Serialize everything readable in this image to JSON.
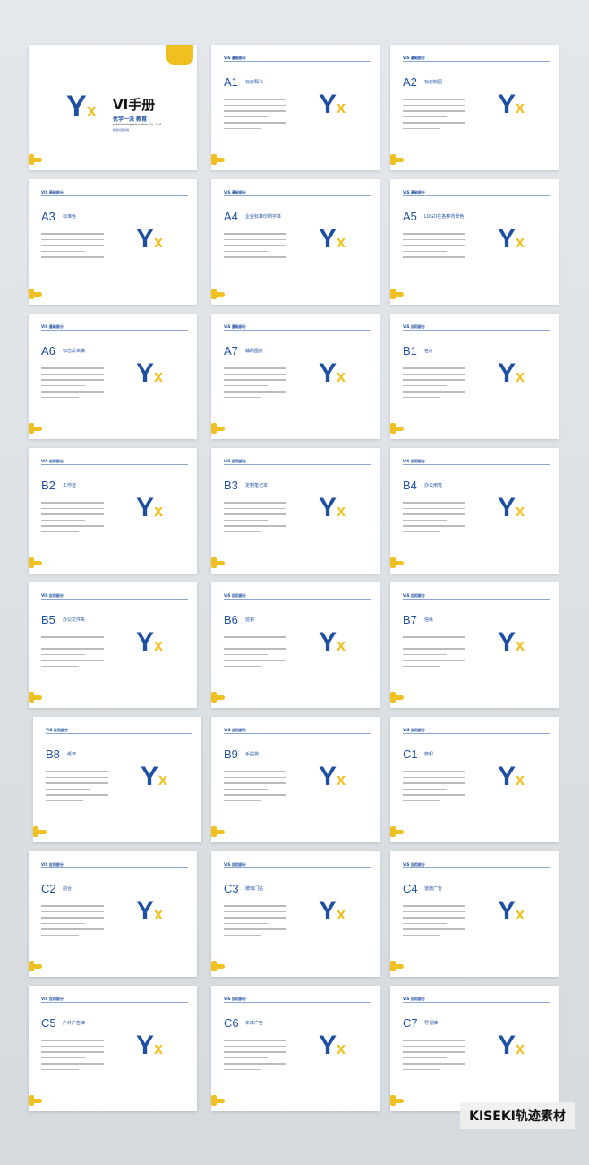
{
  "cover": {
    "title": "VI手册",
    "company_cn": "优学一派 教育",
    "company_en": "outstanding education Co., Ltd",
    "tag": "视觉识别系统"
  },
  "pages": [
    {
      "code": "A1",
      "sub": "标志释义",
      "header": "VIS 基础部分"
    },
    {
      "code": "A2",
      "sub": "标志制图",
      "header": "VIS 基础部分"
    },
    {
      "code": "A3",
      "sub": "标准色",
      "header": "VIS 基础部分"
    },
    {
      "code": "A4",
      "sub": "企业标准印刷字体",
      "header": "VIS 基础部分"
    },
    {
      "code": "A5",
      "sub": "LOGO在各种背景色",
      "header": "VIS 基础部分"
    },
    {
      "code": "A6",
      "sub": "标志反白稿",
      "header": "VIS 基础部分"
    },
    {
      "code": "A7",
      "sub": "辅助图形",
      "header": "VIS 基础部分"
    },
    {
      "code": "B1",
      "sub": "名片",
      "header": "VIS 应用部分"
    },
    {
      "code": "B2",
      "sub": "工作证",
      "header": "VIS 应用部分"
    },
    {
      "code": "B3",
      "sub": "定制笔记本",
      "header": "VIS 应用部分"
    },
    {
      "code": "B4",
      "sub": "办公用笔",
      "header": "VIS 应用部分"
    },
    {
      "code": "B5",
      "sub": "办公文件夹",
      "header": "VIS 应用部分"
    },
    {
      "code": "B6",
      "sub": "信封",
      "header": "VIS 应用部分"
    },
    {
      "code": "B7",
      "sub": "信纸",
      "header": "VIS 应用部分"
    },
    {
      "code": "B8",
      "sub": "纸杯",
      "header": "VIS 应用部分"
    },
    {
      "code": "B9",
      "sub": "手提袋",
      "header": "VIS 应用部分"
    },
    {
      "code": "C1",
      "sub": "旗帜",
      "header": "VIS 应用部分"
    },
    {
      "code": "C2",
      "sub": "前台",
      "header": "VIS 应用部分"
    },
    {
      "code": "C3",
      "sub": "玻璃门贴",
      "header": "VIS 应用部分"
    },
    {
      "code": "C4",
      "sub": "道旗广告",
      "header": "VIS 应用部分"
    },
    {
      "code": "C5",
      "sub": "户外广告牌",
      "header": "VIS 应用部分"
    },
    {
      "code": "C6",
      "sub": "车体广告",
      "header": "VIS 应用部分"
    },
    {
      "code": "C7",
      "sub": "导视牌",
      "header": "VIS 应用部分"
    }
  ],
  "watermark": "KISEKI轨迹素材",
  "colors": {
    "brand_blue": "#1e4fa3",
    "brand_yellow": "#f0c020"
  }
}
